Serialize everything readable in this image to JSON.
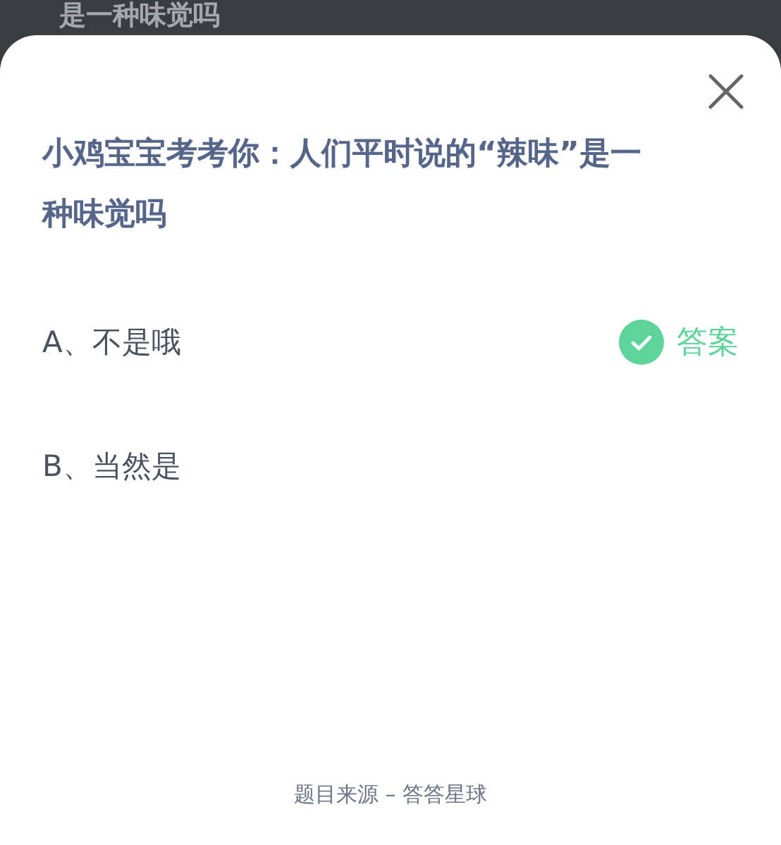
{
  "background": {
    "text": "是一种味觉吗"
  },
  "dialog": {
    "question": "小鸡宝宝考考你：人们平时说的“辣味”是一种味觉吗",
    "options": [
      {
        "label": "A、不是哦",
        "correct": true,
        "answer_label": "答案"
      },
      {
        "label": "B、当然是",
        "correct": false
      }
    ],
    "source": "题目来源 – 答答星球"
  }
}
